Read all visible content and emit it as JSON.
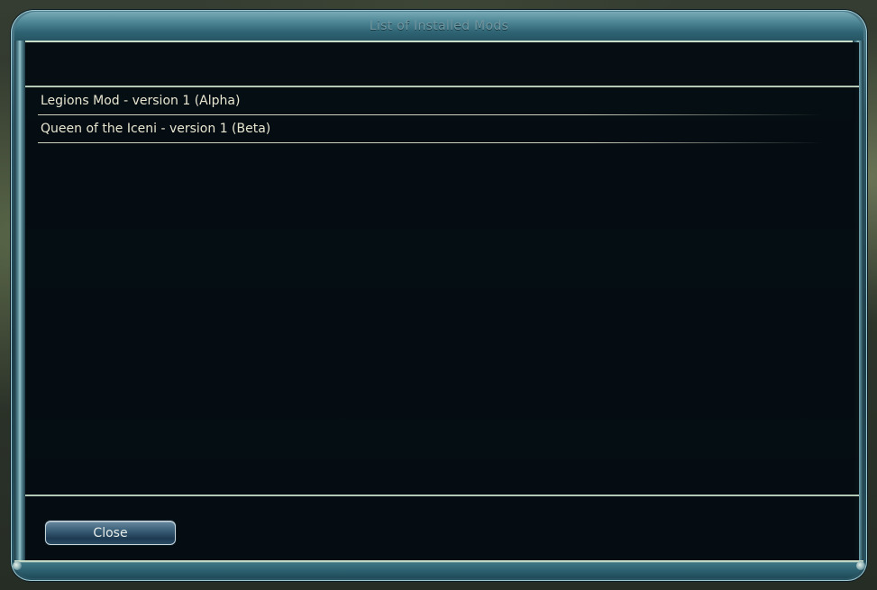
{
  "window": {
    "title": "List of Installed Mods"
  },
  "mods": [
    {
      "label": "Legions Mod - version 1 (Alpha)"
    },
    {
      "label": "Queen of the Iceni - version 1 (Beta)"
    }
  ],
  "footer": {
    "close_label": "Close"
  },
  "colors": {
    "frame_accent": "#4f8796",
    "panel_background": "#040b10",
    "text": "#f0ecd6",
    "title_text": "#6f96a0"
  }
}
